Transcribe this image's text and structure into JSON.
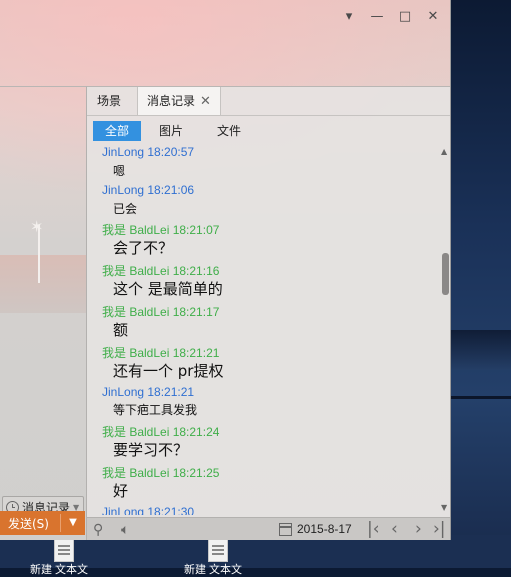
{
  "window": {
    "controls": {
      "dropdown": "▾",
      "minimize": "—",
      "maximize": "□",
      "close": "✕"
    }
  },
  "tabs": [
    {
      "label": "场景"
    },
    {
      "label": "消息记录",
      "close": "✕"
    }
  ],
  "filters": [
    {
      "label": "全部",
      "active": true
    },
    {
      "label": "图片"
    },
    {
      "label": "文件"
    }
  ],
  "messages": [
    {
      "sender": "JinLong",
      "time": "18:20:57",
      "text": "嗯",
      "color": "#2f6fd1"
    },
    {
      "sender": "JinLong",
      "time": "18:21:06",
      "text": "已会",
      "color": "#2f6fd1"
    },
    {
      "sender": "我是 BaldLei",
      "time": "18:21:07",
      "text": "会了不？",
      "color": "#3fae49"
    },
    {
      "sender": "我是 BaldLei",
      "time": "18:21:16",
      "text": "这个 是最简单的",
      "color": "#3fae49"
    },
    {
      "sender": "我是 BaldLei",
      "time": "18:21:17",
      "text": "额",
      "color": "#3fae49"
    },
    {
      "sender": "我是 BaldLei",
      "time": "18:21:21",
      "text": "还有一个 pr提权",
      "color": "#3fae49"
    },
    {
      "sender": "JinLong",
      "time": "18:21:21",
      "text": "等下疤工具发我",
      "color": "#2f6fd1"
    },
    {
      "sender": "我是 BaldLei",
      "time": "18:21:24",
      "text": "要学习不？",
      "color": "#3fae49"
    },
    {
      "sender": "我是 BaldLei",
      "time": "18:21:25",
      "text": "好",
      "color": "#3fae49"
    },
    {
      "sender": "JinLong",
      "time": "18:21:30",
      "text": "",
      "color": "#2f6fd1"
    }
  ],
  "left": {
    "history_button": "消息记录",
    "send_button": "发送(S)"
  },
  "bottom": {
    "date": "2015-8-17",
    "icons": [
      "search-icon",
      "volume-icon",
      "calendar-icon",
      "first-page-icon",
      "prev-page-icon",
      "next-page-icon",
      "last-page-icon"
    ]
  },
  "desktop": {
    "icons": [
      {
        "label": "新建 文本文"
      },
      {
        "label": "新建 文本文"
      }
    ]
  }
}
